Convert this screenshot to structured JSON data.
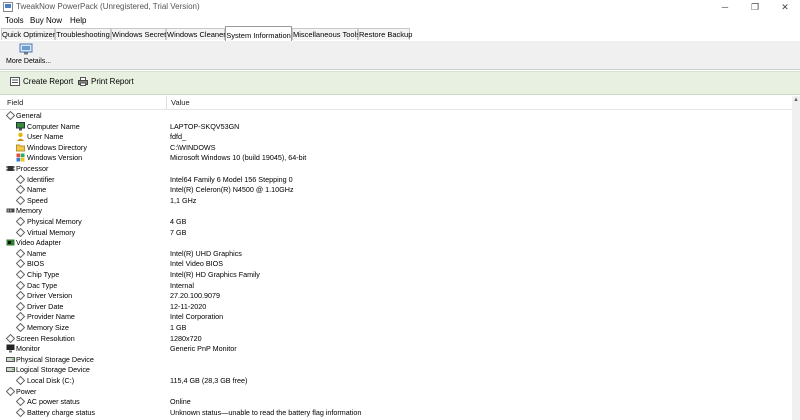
{
  "window": {
    "title": "TweakNow PowerPack (Unregistered, Trial Version)"
  },
  "menu": [
    "Tools",
    "Buy Now",
    "Help"
  ],
  "tabs": [
    {
      "label": "Quick Optimizer",
      "active": false
    },
    {
      "label": "Troubleshooting",
      "active": false
    },
    {
      "label": "Windows Secret",
      "active": false
    },
    {
      "label": "Windows Cleaner",
      "active": false
    },
    {
      "label": "System Information",
      "active": true
    },
    {
      "label": "Miscellaneous Tools",
      "active": false
    },
    {
      "label": "Restore Backup",
      "active": false
    }
  ],
  "toolbar": {
    "more_details_label": "More Details...",
    "create_report_label": "Create Report",
    "print_report_label": "Print Report"
  },
  "table": {
    "headers": {
      "field": "Field",
      "value": "Value"
    },
    "rows": [
      {
        "level": 0,
        "icon": "diamond",
        "field": "General",
        "value": ""
      },
      {
        "level": 1,
        "icon": "computer",
        "field": "Computer Name",
        "value": "LAPTOP-SKQV53GN"
      },
      {
        "level": 1,
        "icon": "user",
        "field": "User Name",
        "value": "fdfd_"
      },
      {
        "level": 1,
        "icon": "folder",
        "field": "Windows Directory",
        "value": "C:\\WINDOWS"
      },
      {
        "level": 1,
        "icon": "windows",
        "field": "Windows Version",
        "value": "Microsoft Windows 10  (build 19045), 64-bit"
      },
      {
        "level": 0,
        "icon": "chip",
        "field": "Processor",
        "value": ""
      },
      {
        "level": 1,
        "icon": "diamond",
        "field": "Identifier",
        "value": "Intel64 Family 6 Model 156 Stepping 0"
      },
      {
        "level": 1,
        "icon": "diamond",
        "field": "Name",
        "value": "Intel(R) Celeron(R) N4500 @ 1.10GHz"
      },
      {
        "level": 1,
        "icon": "diamond",
        "field": "Speed",
        "value": "1,1 GHz"
      },
      {
        "level": 0,
        "icon": "memory",
        "field": "Memory",
        "value": ""
      },
      {
        "level": 1,
        "icon": "diamond",
        "field": "Physical Memory",
        "value": "4 GB"
      },
      {
        "level": 1,
        "icon": "diamond",
        "field": "Virtual Memory",
        "value": "7 GB"
      },
      {
        "level": 0,
        "icon": "videocard",
        "field": "Video Adapter",
        "value": ""
      },
      {
        "level": 1,
        "icon": "diamond",
        "field": "Name",
        "value": "Intel(R) UHD Graphics"
      },
      {
        "level": 1,
        "icon": "diamond",
        "field": "BIOS",
        "value": "Intel Video BIOS"
      },
      {
        "level": 1,
        "icon": "diamond",
        "field": "Chip Type",
        "value": "Intel(R) HD Graphics Family"
      },
      {
        "level": 1,
        "icon": "diamond",
        "field": "Dac Type",
        "value": "Internal"
      },
      {
        "level": 1,
        "icon": "diamond",
        "field": "Driver Version",
        "value": "27.20.100.9079"
      },
      {
        "level": 1,
        "icon": "diamond",
        "field": "Driver Date",
        "value": "12-11-2020"
      },
      {
        "level": 1,
        "icon": "diamond",
        "field": "Provider Name",
        "value": "Intel Corporation"
      },
      {
        "level": 1,
        "icon": "diamond",
        "field": "Memory Size",
        "value": "1 GB"
      },
      {
        "level": 0,
        "icon": "diamond",
        "field": "Screen Resolution",
        "value": "1280x720"
      },
      {
        "level": 0,
        "icon": "monitor",
        "field": "Monitor",
        "value": "Generic PnP Monitor"
      },
      {
        "level": 0,
        "icon": "drive",
        "field": "Physical Storage Device",
        "value": ""
      },
      {
        "level": 0,
        "icon": "drive",
        "field": "Logical Storage Device",
        "value": ""
      },
      {
        "level": 1,
        "icon": "diamond",
        "field": "Local Disk (C:)",
        "value": "115,4 GB (28,3 GB free)"
      },
      {
        "level": 0,
        "icon": "power",
        "field": "Power",
        "value": ""
      },
      {
        "level": 1,
        "icon": "diamond",
        "field": "AC power status",
        "value": "Online"
      },
      {
        "level": 1,
        "icon": "diamond",
        "field": "Battery charge status",
        "value": "Unknown status—unable to read the battery flag information"
      }
    ]
  },
  "colors": {
    "accent_toolbar": "#e7f0e1",
    "tab_active_border": "#9a9a9a"
  }
}
